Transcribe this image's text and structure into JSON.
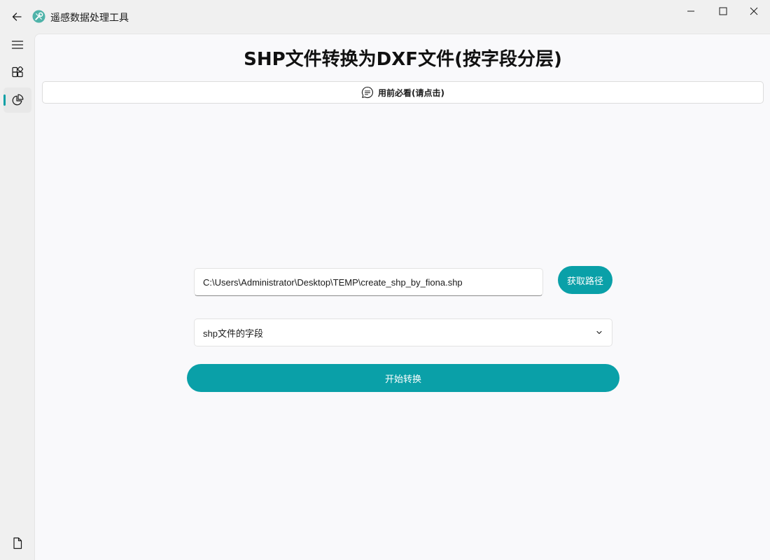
{
  "window": {
    "app_title": "遥感数据处理工具",
    "accent_color": "#0aa0a8"
  },
  "nav": {
    "items": [
      {
        "icon": "hamburger-menu-icon"
      },
      {
        "icon": "apps-icon"
      },
      {
        "icon": "pie-chart-icon",
        "selected": true
      },
      {
        "icon": "document-icon"
      }
    ]
  },
  "page": {
    "title": "SHP文件转换为DXF文件(按字段分层)",
    "notice_label": "用前必看(请点击)",
    "path_input_value": "C:\\Users\\Administrator\\Desktop\\TEMP\\create_shp_by_fiona.shp",
    "browse_label": "获取路径",
    "field_select_label": "shp文件的字段",
    "start_label": "开始转换"
  }
}
